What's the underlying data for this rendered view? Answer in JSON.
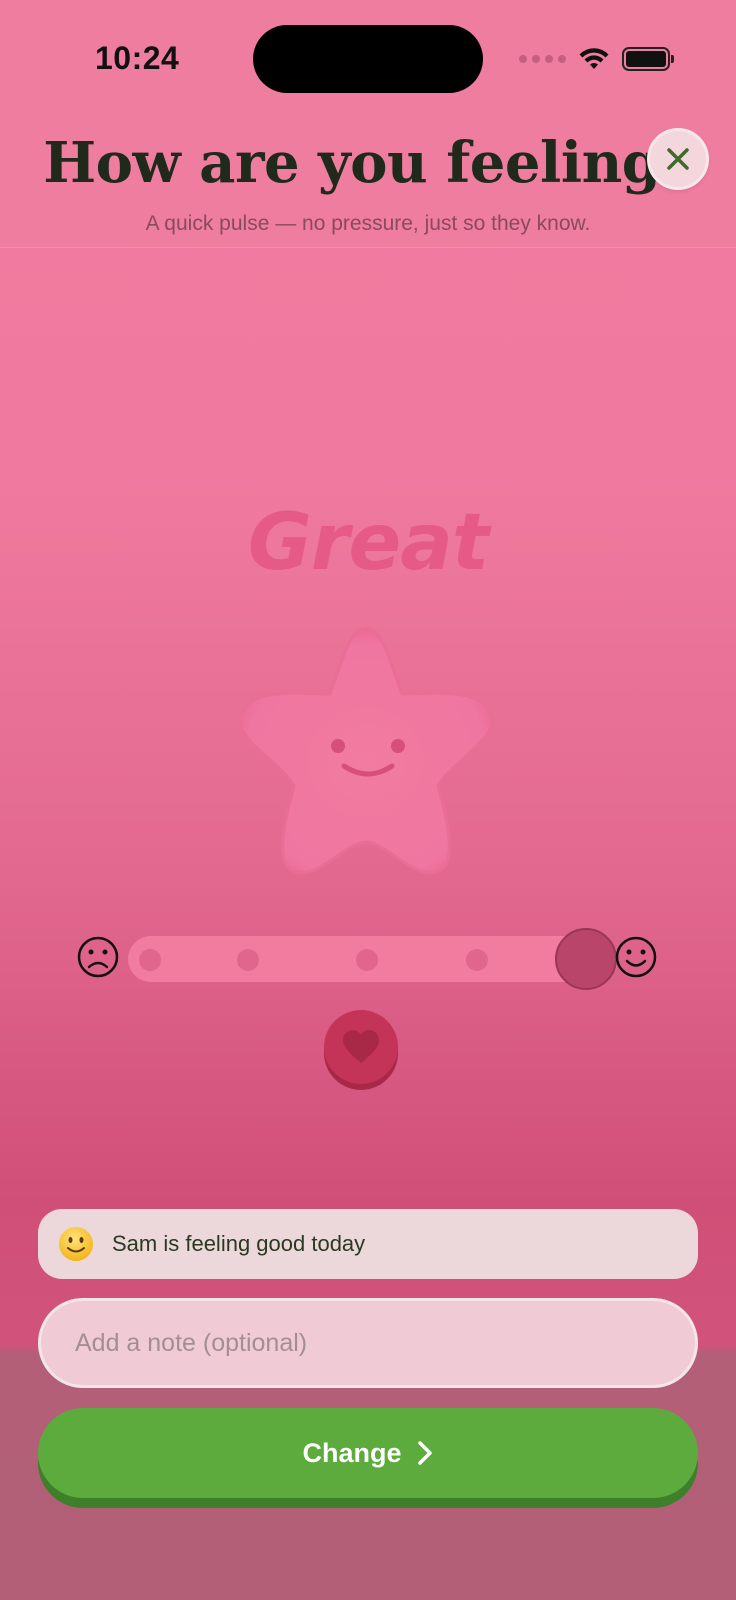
{
  "status_bar": {
    "time": "10:24"
  },
  "header": {
    "title": "How are you feeling?",
    "subtitle": "A quick pulse — no pressure, just so they know."
  },
  "mood": {
    "label": "Great",
    "level": 5,
    "level_max": 5
  },
  "status_card": {
    "text": "Sam is feeling good today"
  },
  "note": {
    "placeholder": "Add a note (optional)",
    "value": ""
  },
  "action": {
    "label": "Change"
  },
  "colors": {
    "accent_green": "#5cab3c",
    "mood_pink": "#e65a87",
    "thumb": "#b9456a",
    "heart": "#c43358"
  },
  "icons": {
    "close": "close-icon",
    "sad": "sad-face-icon",
    "happy": "happy-face-icon",
    "heart": "heart-icon",
    "chevron": "chevron-right-icon"
  }
}
